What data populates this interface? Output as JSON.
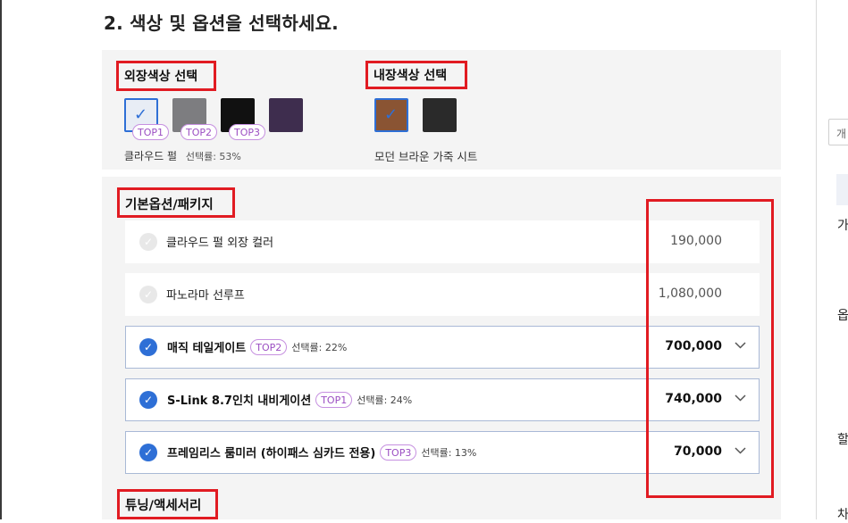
{
  "page": {
    "section_title": "2. 색상 및 옵션을 선택하세요."
  },
  "exterior": {
    "label": "외장색상 선택",
    "swatches": [
      {
        "color": "#e8edf5",
        "selected": true,
        "badge": "TOP1"
      },
      {
        "color": "#7d7d80",
        "selected": false,
        "badge": "TOP2"
      },
      {
        "color": "#111111",
        "selected": false,
        "badge": "TOP3"
      },
      {
        "color": "#3e2d4e",
        "selected": false,
        "badge": ""
      }
    ],
    "selected_name": "클라우드 펄",
    "selected_rate": "선택률: 53%"
  },
  "interior": {
    "label": "내장색상 선택",
    "swatches": [
      {
        "color": "#8a5433",
        "selected": true
      },
      {
        "color": "#2a2a2a",
        "selected": false
      }
    ],
    "selected_name": "모던 브라운 가죽 시트"
  },
  "basic_options": {
    "label": "기본옵션/패키지",
    "items": [
      {
        "name": "클라우드 펄 외장 컬러",
        "badge": "",
        "rate": "",
        "price": "190,000",
        "selected": false
      },
      {
        "name": "파노라마 선루프",
        "badge": "",
        "rate": "",
        "price": "1,080,000",
        "selected": false
      },
      {
        "name": "매직 테일게이트",
        "badge": "TOP2",
        "rate": "선택률: 22%",
        "price": "700,000",
        "selected": true
      },
      {
        "name": "S-Link 8.7인치 내비게이션",
        "badge": "TOP1",
        "rate": "선택률: 24%",
        "price": "740,000",
        "selected": true
      },
      {
        "name": "프레임리스 룸미러 (하이패스 심카드 전용)",
        "badge": "TOP3",
        "rate": "선택률: 13%",
        "price": "70,000",
        "selected": true
      }
    ]
  },
  "tuning": {
    "label": "튜닝/액세서리"
  },
  "right_panel": {
    "box_text": "개",
    "texts": [
      "가",
      "옵",
      "할",
      "차"
    ]
  },
  "icons": {
    "check": "check-icon",
    "chevron": "chevron-down-icon"
  },
  "colors": {
    "annotation_red": "#e11b22",
    "accent_blue": "#2e6fd6",
    "badge_purple": "#9b4ec2"
  }
}
